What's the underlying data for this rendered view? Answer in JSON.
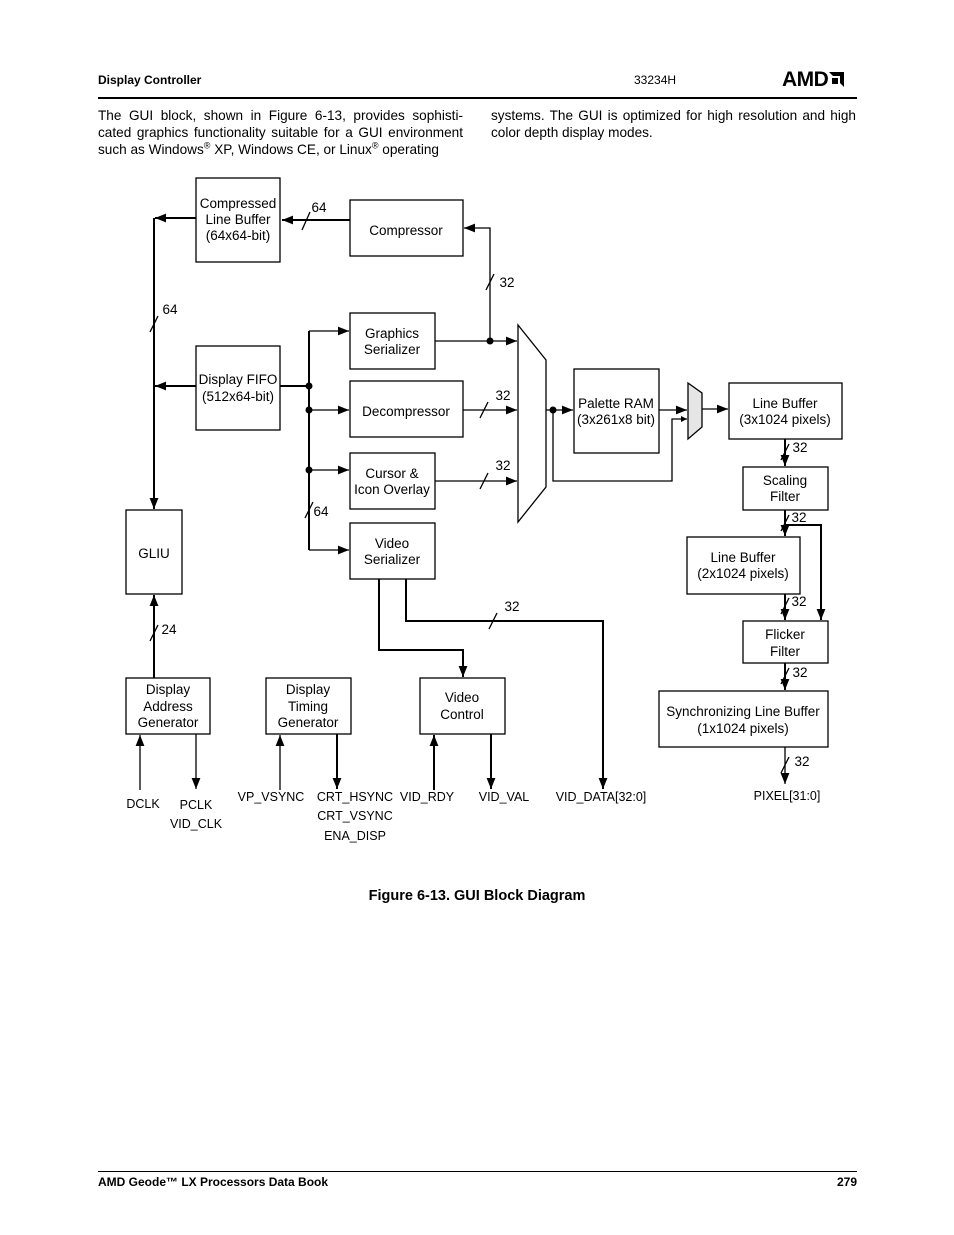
{
  "header": {
    "section": "Display Controller",
    "doc_number": "33234H",
    "logo_text": "AMD"
  },
  "body": {
    "left_column": [
      "The GUI block, shown in Figure 6-13, provides sophisti-cated graphics functionality suitable for a GUI environment such as Windows",
      "®",
      " XP, Windows CE, or Linux",
      "®",
      " operating"
    ],
    "right_column": "systems. The GUI is optimized for high resolution and high color depth display modes."
  },
  "diagram": {
    "blocks": {
      "compressed_line_buffer": [
        "Compressed",
        "Line Buffer",
        "(64x64-bit)"
      ],
      "compressor": "Compressor",
      "display_fifo": [
        "Display FIFO",
        "(512x64-bit)"
      ],
      "graphics_serializer": [
        "Graphics",
        "Serializer"
      ],
      "decompressor": "Decompressor",
      "cursor_overlay": [
        "Cursor &",
        "Icon Overlay"
      ],
      "video_serializer": [
        "Video",
        "Serializer"
      ],
      "palette_ram": [
        "Palette RAM",
        "(3x261x8 bit)"
      ],
      "line_buffer_3x": [
        "Line Buffer",
        "(3x1024 pixels)"
      ],
      "scaling_filter": [
        "Scaling",
        "Filter"
      ],
      "line_buffer_2x": [
        "Line Buffer",
        "(2x1024 pixels)"
      ],
      "flicker_filter": [
        "Flicker",
        "Filter"
      ],
      "sync_line_buffer": [
        "Synchronizing Line Buffer",
        "(1x1024 pixels)"
      ],
      "gliu": "GLIU",
      "display_address_generator": [
        "Display",
        "Address",
        "Generator"
      ],
      "display_timing_generator": [
        "Display",
        "Timing",
        "Generator"
      ],
      "video_control": [
        "Video",
        "Control"
      ]
    },
    "bus_widths": {
      "compressed_lb": "64",
      "left_bus": "64",
      "compressor_in": "32",
      "decompressor_out": "32",
      "cursor_out": "32",
      "video_ser_in": "64",
      "vid_data": "32",
      "dag_out": "24",
      "lb3_out": "32",
      "scaling_out": "32",
      "lb2_out": "32",
      "flicker_out": "32",
      "pixel_out": "32"
    },
    "signals": {
      "dclk": "DCLK",
      "pclk": "PCLK",
      "vid_clk": "VID_CLK",
      "vp_vsync": "VP_VSYNC",
      "crt_hsync": "CRT_HSYNC",
      "crt_vsync": "CRT_VSYNC",
      "ena_disp": "ENA_DISP",
      "vid_rdy": "VID_RDY",
      "vid_val": "VID_VAL",
      "vid_data": "VID_DATA[32:0]",
      "pixel": "PIXEL[31:0]"
    }
  },
  "caption": "Figure 6-13.  GUI Block Diagram",
  "footer": {
    "book": "AMD Geode™ LX Processors Data Book",
    "page": "279"
  }
}
